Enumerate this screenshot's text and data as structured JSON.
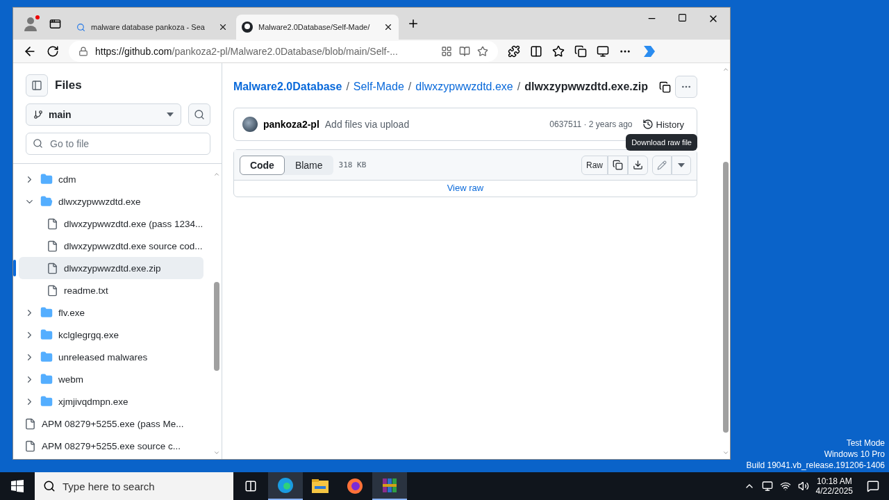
{
  "desktop": {
    "watermark_lines": [
      "Test Mode",
      "Windows 10 Pro",
      "Build 19041.vb_release.191206-1406"
    ]
  },
  "browser": {
    "tabs": [
      {
        "title": "malware database pankoza - Sea",
        "kind": "search",
        "selected": false
      },
      {
        "title": "Malware2.0Database/Self-Made/",
        "kind": "github",
        "selected": true
      }
    ],
    "address": {
      "host": "https://github.com",
      "path": "/pankoza2-pl/Malware2.0Database/blob/main/Self-..."
    }
  },
  "sidebar": {
    "title": "Files",
    "branch": "main",
    "search": {
      "placeholder": "Go to file"
    },
    "tree": [
      {
        "name": "cdm",
        "kind": "folder",
        "expanded": false,
        "selected": false
      },
      {
        "name": "dlwxzypwwzdtd.exe",
        "kind": "folder",
        "expanded": true,
        "selected": false,
        "children": [
          {
            "name": "dlwxzypwwzdtd.exe (pass 1234...",
            "kind": "file",
            "selected": false
          },
          {
            "name": "dlwxzypwwzdtd.exe source cod...",
            "kind": "file",
            "selected": false
          },
          {
            "name": "dlwxzypwwzdtd.exe.zip",
            "kind": "file",
            "selected": true
          },
          {
            "name": "readme.txt",
            "kind": "file",
            "selected": false
          }
        ]
      },
      {
        "name": "flv.exe",
        "kind": "folder",
        "expanded": false,
        "selected": false
      },
      {
        "name": "kclglegrgq.exe",
        "kind": "folder",
        "expanded": false,
        "selected": false
      },
      {
        "name": "unreleased malwares",
        "kind": "folder",
        "expanded": false,
        "selected": false
      },
      {
        "name": "webm",
        "kind": "folder",
        "expanded": false,
        "selected": false
      },
      {
        "name": "xjmjivqdmpn.exe",
        "kind": "folder",
        "expanded": false,
        "selected": false
      },
      {
        "name": "APM 08279+5255.exe (pass Me...",
        "kind": "file",
        "selected": false
      },
      {
        "name": "APM 08279+5255.exe source c...",
        "kind": "file",
        "selected": false
      }
    ]
  },
  "breadcrumb": {
    "links": [
      "Malware2.0Database",
      "Self-Made",
      "dlwxzypwwzdtd.exe"
    ],
    "separator": "/",
    "current": "dlwxzypwwzdtd.exe.zip"
  },
  "commit": {
    "author": "pankoza2-pl",
    "message": "Add files via upload",
    "meta": "0637511 · 2 years ago",
    "history": "History"
  },
  "tooltip": "Download raw file",
  "file_view": {
    "tabs": [
      {
        "label": "Code",
        "selected": true
      },
      {
        "label": "Blame",
        "selected": false
      }
    ],
    "size": "318  KB",
    "raw": "Raw",
    "view_raw": "View raw"
  },
  "taskbar": {
    "search_placeholder": "Type here to search",
    "time": "10:18 AM",
    "date": "4/22/2025"
  }
}
